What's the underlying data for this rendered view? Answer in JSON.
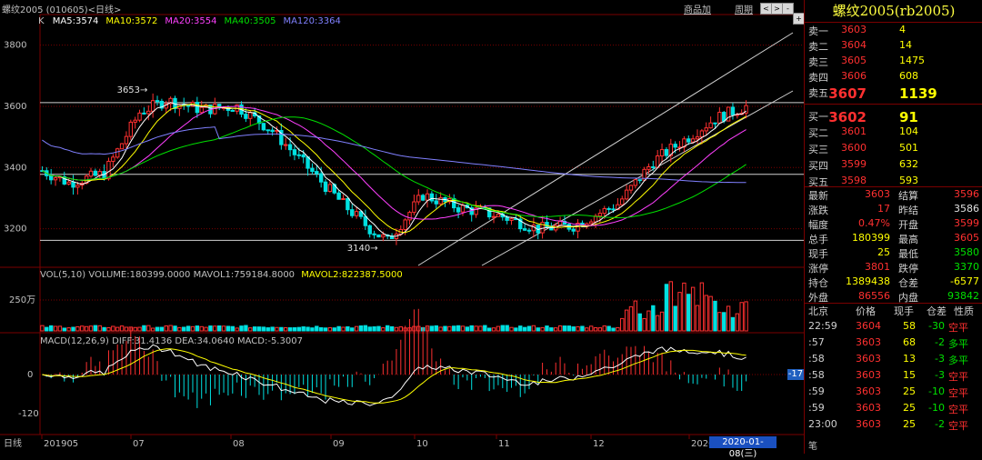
{
  "window": {
    "title": "螺纹2005 (010605)<日线>",
    "links": [
      "商品加",
      "周期"
    ],
    "controls": [
      "<",
      ">",
      "-",
      "+",
      "□"
    ]
  },
  "chart": {
    "main_label": "K",
    "ma_legend": [
      {
        "text": "MA5:3574",
        "color": "#ffffff"
      },
      {
        "text": "MA10:3572",
        "color": "#ffff00"
      },
      {
        "text": "MA20:3554",
        "color": "#ff40ff"
      },
      {
        "text": "MA40:3505",
        "color": "#00e000"
      },
      {
        "text": "MA120:3364",
        "color": "#8080ff"
      }
    ],
    "y_ticks": [
      "3800",
      "3600",
      "3400",
      "3200"
    ],
    "high_mark": "3653",
    "low_mark": "3140",
    "vol_legend": "VOL(5,10)  VOLUME:180399.0000  MAVOL1:759184.8000",
    "vol_legend2": "MAVOL2:822387.5000",
    "vol_tick": "250万",
    "macd_legend": "MACD(12,26,9)  DIFF:31.4136  DEA:34.0640  MACD:-5.3007",
    "macd_ticks": [
      "0",
      "-120"
    ],
    "macd_badge": "-17",
    "x_ticks": [
      "日线",
      "201905",
      "07",
      "08",
      "09",
      "10",
      "11",
      "12",
      "202001"
    ],
    "date_badge": "2020-01-08(三)",
    "colors": {
      "up": "#ff3030",
      "down": "#00e0e0",
      "grid": "#7a0000"
    }
  },
  "chart_data": {
    "type": "candlestick",
    "title": "螺纹2005 (010605)",
    "ylim": [
      3080,
      3900
    ],
    "range": {
      "high": 3653,
      "low": 3140
    },
    "ma": {
      "MA5": 3574,
      "MA10": 3572,
      "MA20": 3554,
      "MA40": 3505,
      "MA120": 3364
    },
    "volume": 180399,
    "mavol1": 759184.8,
    "mavol2": 822387.5,
    "macd": {
      "DIFF": 31.4136,
      "DEA": 34.064,
      "MACD": -5.3007
    }
  },
  "side": {
    "title": "螺纹2005(rb2005)",
    "asks": [
      {
        "label": "卖五",
        "price": "3607",
        "vol": "1139"
      },
      {
        "label": "卖四",
        "price": "3606",
        "vol": "608"
      },
      {
        "label": "卖三",
        "price": "3605",
        "vol": "1475"
      },
      {
        "label": "卖二",
        "price": "3604",
        "vol": "14"
      },
      {
        "label": "卖一",
        "price": "3603",
        "vol": "4"
      }
    ],
    "bids": [
      {
        "label": "买一",
        "price": "3602",
        "vol": "91"
      },
      {
        "label": "买二",
        "price": "3601",
        "vol": "104"
      },
      {
        "label": "买三",
        "price": "3600",
        "vol": "501"
      },
      {
        "label": "买四",
        "price": "3599",
        "vol": "632"
      },
      {
        "label": "买五",
        "price": "3598",
        "vol": "593"
      }
    ],
    "stats": [
      {
        "l1": "最新",
        "v1": "3603",
        "c1": "red",
        "l2": "结算",
        "v2": "3596",
        "c2": "red"
      },
      {
        "l1": "涨跌",
        "v1": "17",
        "c1": "red",
        "l2": "昨结",
        "v2": "3586",
        "c2": "wht"
      },
      {
        "l1": "幅度",
        "v1": "0.47%",
        "c1": "red",
        "l2": "开盘",
        "v2": "3599",
        "c2": "red"
      },
      {
        "l1": "总手",
        "v1": "180399",
        "c1": "yel",
        "l2": "最高",
        "v2": "3605",
        "c2": "red"
      },
      {
        "l1": "现手",
        "v1": "25",
        "c1": "yel",
        "l2": "最低",
        "v2": "3580",
        "c2": "grn"
      },
      {
        "l1": "涨停",
        "v1": "3801",
        "c1": "red",
        "l2": "跌停",
        "v2": "3370",
        "c2": "grn"
      },
      {
        "l1": "持仓",
        "v1": "1389438",
        "c1": "yel",
        "l2": "仓差",
        "v2": "-6577",
        "c2": "yel"
      },
      {
        "l1": "外盘",
        "v1": "86556",
        "c1": "red",
        "l2": "内盘",
        "v2": "93842",
        "c2": "grn"
      }
    ],
    "tick_header": [
      "北京",
      "价格",
      "现手",
      "仓差",
      "性质"
    ],
    "ticks": [
      {
        "time": "22:59",
        "price": "3604",
        "qty": "58",
        "diff": "-30",
        "nature": "空平",
        "ncolor": "red"
      },
      {
        "time": ":57",
        "price": "3603",
        "qty": "68",
        "diff": "-2",
        "nature": "多平",
        "ncolor": "grn"
      },
      {
        "time": ":58",
        "price": "3603",
        "qty": "13",
        "diff": "-3",
        "nature": "多平",
        "ncolor": "grn"
      },
      {
        "time": ":58",
        "price": "3603",
        "qty": "15",
        "diff": "-3",
        "nature": "空平",
        "ncolor": "red"
      },
      {
        "time": ":59",
        "price": "3603",
        "qty": "25",
        "diff": "-10",
        "nature": "空平",
        "ncolor": "red"
      },
      {
        "time": ":59",
        "price": "3603",
        "qty": "25",
        "diff": "-10",
        "nature": "空平",
        "ncolor": "red"
      },
      {
        "time": "23:00",
        "price": "3603",
        "qty": "25",
        "diff": "-2",
        "nature": "空平",
        "ncolor": "red"
      }
    ],
    "footer": "笔"
  }
}
